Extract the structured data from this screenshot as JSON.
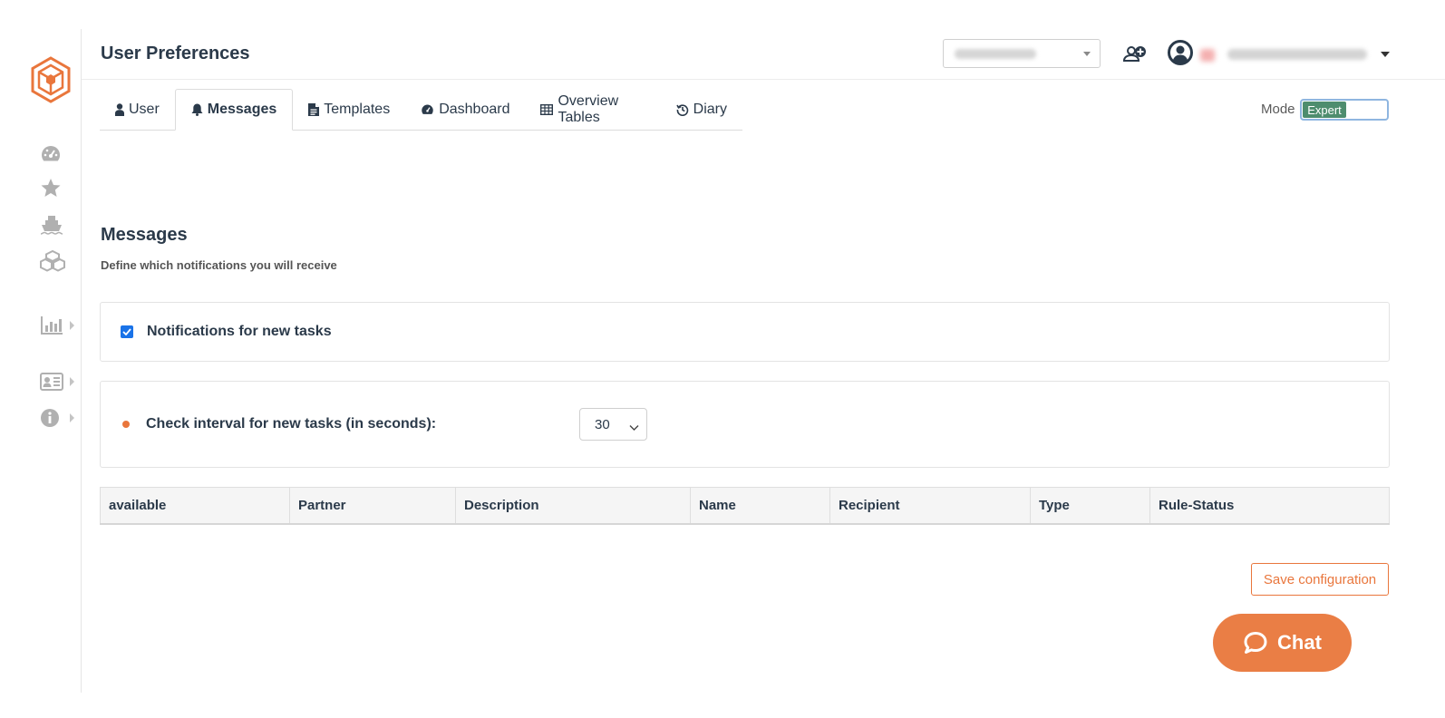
{
  "header": {
    "title": "User Preferences"
  },
  "sidebar": {
    "items": [
      {
        "icon": "dashboard-icon"
      },
      {
        "icon": "star-icon"
      },
      {
        "icon": "ship-icon"
      },
      {
        "icon": "boxes-icon"
      },
      {
        "icon": "bar-chart-icon"
      },
      {
        "icon": "id-card-icon"
      },
      {
        "icon": "info-icon"
      }
    ]
  },
  "tabs": [
    {
      "label": "User",
      "icon": "user-icon"
    },
    {
      "label": "Messages",
      "icon": "bell-icon",
      "active": true
    },
    {
      "label": "Templates",
      "icon": "file-icon"
    },
    {
      "label": "Dashboard",
      "icon": "dashboard-icon"
    },
    {
      "label": "Overview Tables",
      "icon": "table-icon"
    },
    {
      "label": "Diary",
      "icon": "history-icon"
    }
  ],
  "mode": {
    "label": "Mode",
    "value": "Expert"
  },
  "section": {
    "title": "Messages",
    "subtitle": "Define which notifications you will receive"
  },
  "notifications": {
    "label": "Notifications for new tasks",
    "checked": true
  },
  "interval": {
    "label": "Check interval for new tasks (in seconds):",
    "value": "30"
  },
  "table": {
    "columns": [
      "available",
      "Partner",
      "Description",
      "Name",
      "Recipient",
      "Type",
      "Rule-Status"
    ]
  },
  "actions": {
    "save_label": "Save configuration"
  },
  "chat": {
    "label": "Chat"
  },
  "colors": {
    "accent": "#e9763c",
    "checkbox": "#1a73e8",
    "toggle_on": "#4e8d6e"
  }
}
